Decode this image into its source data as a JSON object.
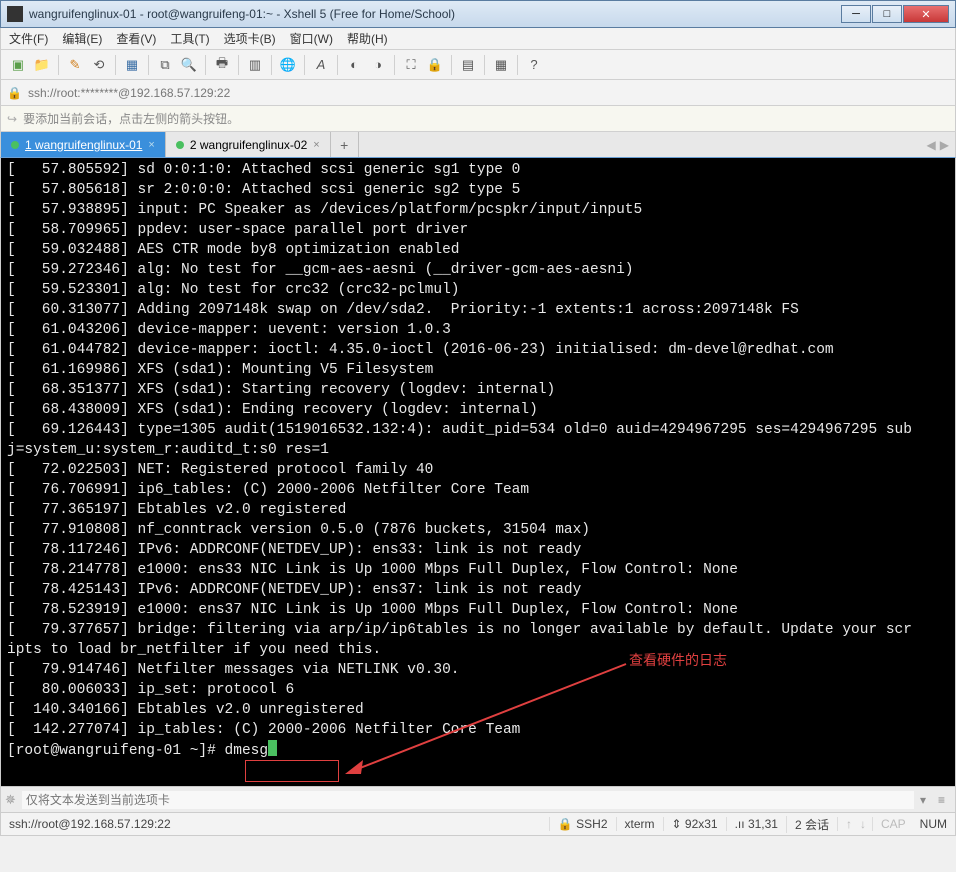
{
  "window": {
    "title": "wangruifenglinux-01 - root@wangruifeng-01:~ - Xshell 5 (Free for Home/School)"
  },
  "menu": {
    "file": "文件(F)",
    "edit": "编辑(E)",
    "view": "查看(V)",
    "tools": "工具(T)",
    "tabs": "选项卡(B)",
    "window": "窗口(W)",
    "help": "帮助(H)"
  },
  "address": {
    "text": "ssh://root:********@192.168.57.129:22"
  },
  "tip": {
    "text": "要添加当前会话，点击左侧的箭头按钮。"
  },
  "tabs": {
    "t1": "1 wangruifenglinux-01",
    "t2": "2 wangruifenglinux-02"
  },
  "terminal_lines": [
    "[   57.805592] sd 0:0:1:0: Attached scsi generic sg1 type 0",
    "[   57.805618] sr 2:0:0:0: Attached scsi generic sg2 type 5",
    "[   57.938895] input: PC Speaker as /devices/platform/pcspkr/input/input5",
    "[   58.709965] ppdev: user-space parallel port driver",
    "[   59.032488] AES CTR mode by8 optimization enabled",
    "[   59.272346] alg: No test for __gcm-aes-aesni (__driver-gcm-aes-aesni)",
    "[   59.523301] alg: No test for crc32 (crc32-pclmul)",
    "[   60.313077] Adding 2097148k swap on /dev/sda2.  Priority:-1 extents:1 across:2097148k FS",
    "[   61.043206] device-mapper: uevent: version 1.0.3",
    "[   61.044782] device-mapper: ioctl: 4.35.0-ioctl (2016-06-23) initialised: dm-devel@redhat.com",
    "[   61.169986] XFS (sda1): Mounting V5 Filesystem",
    "[   68.351377] XFS (sda1): Starting recovery (logdev: internal)",
    "[   68.438009] XFS (sda1): Ending recovery (logdev: internal)",
    "[   69.126443] type=1305 audit(1519016532.132:4): audit_pid=534 old=0 auid=4294967295 ses=4294967295 subj=system_u:system_r:auditd_t:s0 res=1",
    "[   72.022503] NET: Registered protocol family 40",
    "[   76.706991] ip6_tables: (C) 2000-2006 Netfilter Core Team",
    "[   77.365197] Ebtables v2.0 registered",
    "[   77.910808] nf_conntrack version 0.5.0 (7876 buckets, 31504 max)",
    "[   78.117246] IPv6: ADDRCONF(NETDEV_UP): ens33: link is not ready",
    "[   78.214778] e1000: ens33 NIC Link is Up 1000 Mbps Full Duplex, Flow Control: None",
    "[   78.425143] IPv6: ADDRCONF(NETDEV_UP): ens37: link is not ready",
    "[   78.523919] e1000: ens37 NIC Link is Up 1000 Mbps Full Duplex, Flow Control: None",
    "[   79.377657] bridge: filtering via arp/ip/ip6tables is no longer available by default. Update your scripts to load br_netfilter if you need this.",
    "[   79.914746] Netfilter messages via NETLINK v0.30.",
    "[   80.006033] ip_set: protocol 6",
    "[  140.340166] Ebtables v2.0 unregistered",
    "[  142.277074] ip_tables: (C) 2000-2006 Netfilter Core Team"
  ],
  "prompt": {
    "text": "[root@wangruifeng-01 ~]# ",
    "command": "dmesg"
  },
  "annotation": {
    "text": "查看硬件的日志"
  },
  "send": {
    "placeholder": "仅将文本发送到当前选项卡"
  },
  "status": {
    "left": "ssh://root@192.168.57.129:22",
    "ssh": "SSH2",
    "term": "xterm",
    "size": "92x31",
    "pos": "31,31",
    "sessions": "2 会话",
    "caps": "CAP",
    "num": "NUM"
  }
}
